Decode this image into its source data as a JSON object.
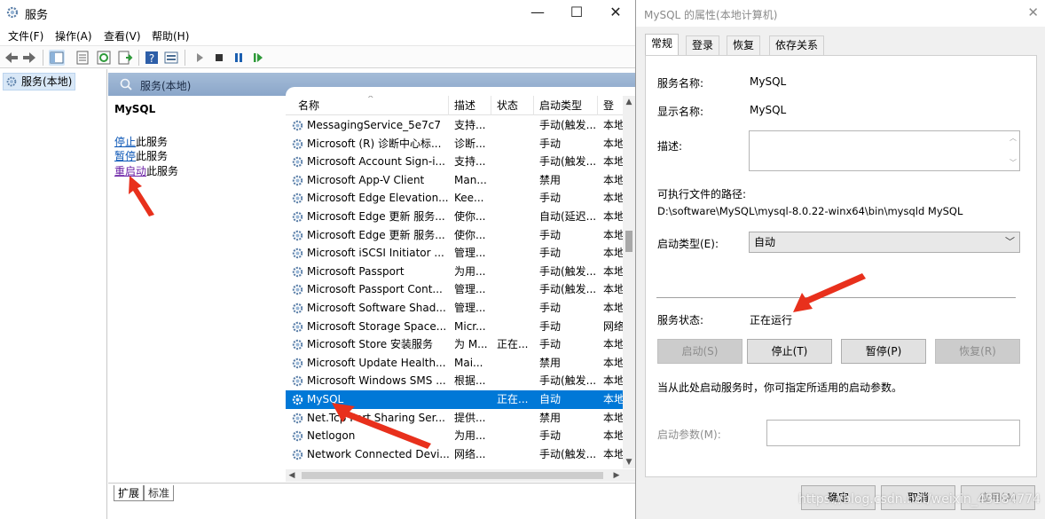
{
  "services_window": {
    "title": "服务",
    "controls": {
      "minimize": "—",
      "maximize": "☐",
      "close": "✕"
    },
    "menu": [
      "文件(F)",
      "操作(A)",
      "查看(V)",
      "帮助(H)"
    ],
    "tree": {
      "item": "服务(本地)"
    },
    "header": "服务(本地)",
    "extended": {
      "service_name": "MySQL",
      "stop_link": "停止",
      "stop_rest": "此服务",
      "pause_link": "暂停",
      "pause_rest": "此服务",
      "restart_link": "重启动",
      "restart_rest": "此服务"
    },
    "columns": {
      "name": "名称",
      "desc": "描述",
      "status": "状态",
      "startup": "启动类型",
      "logon": "登"
    },
    "rows": [
      {
        "name": "MessagingService_5e7c7",
        "desc": "支持...",
        "status": "",
        "startup": "手动(触发...",
        "logon": "本地"
      },
      {
        "name": "Microsoft (R) 诊断中心标...",
        "desc": "诊断...",
        "status": "",
        "startup": "手动",
        "logon": "本地"
      },
      {
        "name": "Microsoft Account Sign-i...",
        "desc": "支持...",
        "status": "",
        "startup": "手动(触发...",
        "logon": "本地"
      },
      {
        "name": "Microsoft App-V Client",
        "desc": "Man...",
        "status": "",
        "startup": "禁用",
        "logon": "本地"
      },
      {
        "name": "Microsoft Edge Elevation...",
        "desc": "Kee...",
        "status": "",
        "startup": "手动",
        "logon": "本地"
      },
      {
        "name": "Microsoft Edge 更新 服务...",
        "desc": "使你...",
        "status": "",
        "startup": "自动(延迟...",
        "logon": "本地"
      },
      {
        "name": "Microsoft Edge 更新 服务...",
        "desc": "使你...",
        "status": "",
        "startup": "手动",
        "logon": "本地"
      },
      {
        "name": "Microsoft iSCSI Initiator ...",
        "desc": "管理...",
        "status": "",
        "startup": "手动",
        "logon": "本地"
      },
      {
        "name": "Microsoft Passport",
        "desc": "为用...",
        "status": "",
        "startup": "手动(触发...",
        "logon": "本地"
      },
      {
        "name": "Microsoft Passport Cont...",
        "desc": "管理...",
        "status": "",
        "startup": "手动(触发...",
        "logon": "本地"
      },
      {
        "name": "Microsoft Software Shad...",
        "desc": "管理...",
        "status": "",
        "startup": "手动",
        "logon": "本地"
      },
      {
        "name": "Microsoft Storage Space...",
        "desc": "Micr...",
        "status": "",
        "startup": "手动",
        "logon": "网络"
      },
      {
        "name": "Microsoft Store 安装服务",
        "desc": "为 M...",
        "status": "正在...",
        "startup": "手动",
        "logon": "本地"
      },
      {
        "name": "Microsoft Update Health...",
        "desc": "Mai...",
        "status": "",
        "startup": "禁用",
        "logon": "本地"
      },
      {
        "name": "Microsoft Windows SMS ...",
        "desc": "根据...",
        "status": "",
        "startup": "手动(触发...",
        "logon": "本地"
      },
      {
        "name": "MySQL",
        "desc": "",
        "status": "正在...",
        "startup": "自动",
        "logon": "本地",
        "selected": true
      },
      {
        "name": "Net.Tcp Port Sharing Ser...",
        "desc": "提供...",
        "status": "",
        "startup": "禁用",
        "logon": "本地"
      },
      {
        "name": "Netlogon",
        "desc": "为用...",
        "status": "",
        "startup": "手动",
        "logon": "本地"
      },
      {
        "name": "Network Connected Devi...",
        "desc": "网络...",
        "status": "",
        "startup": "手动(触发...",
        "logon": "本地"
      }
    ],
    "bottom_tabs": [
      "扩展",
      "标准"
    ]
  },
  "properties": {
    "title": "MySQL 的属性(本地计算机)",
    "close": "✕",
    "tabs": [
      "常规",
      "登录",
      "恢复",
      "依存关系"
    ],
    "service_name_label": "服务名称:",
    "service_name_value": "MySQL",
    "display_name_label": "显示名称:",
    "display_name_value": "MySQL",
    "description_label": "描述:",
    "path_label": "可执行文件的路径:",
    "path_value": "D:\\software\\MySQL\\mysql-8.0.22-winx64\\bin\\mysqld MySQL",
    "startup_type_label": "启动类型(E):",
    "startup_type_value": "自动",
    "status_label": "服务状态:",
    "status_value": "正在运行",
    "buttons": {
      "start": "启动(S)",
      "stop": "停止(T)",
      "pause": "暂停(P)",
      "resume": "恢复(R)"
    },
    "hint": "当从此处启动服务时，你可指定所适用的启动参数。",
    "params_label": "启动参数(M):",
    "footer": {
      "ok": "确定",
      "cancel": "取消",
      "apply": "应用(A)"
    }
  },
  "watermark": "https://blog.csdn.net/weixin_43184774",
  "colors": {
    "selection": "#0078d7",
    "header_strip": "#9bb4d3",
    "arrow": "#e8301c"
  }
}
